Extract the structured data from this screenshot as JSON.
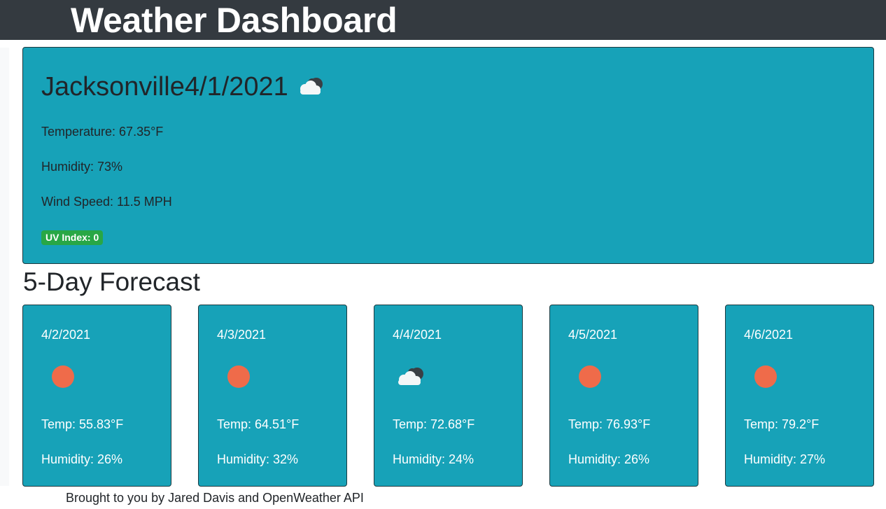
{
  "header": {
    "title": "Weather Dashboard"
  },
  "current": {
    "city": "Jacksonville",
    "date": "4/1/2021",
    "icon": "cloud-icon",
    "temperature": "Temperature: 67.35°F",
    "humidity": "Humidity: 73%",
    "wind": "Wind Speed: 11.5 MPH",
    "uv": "UV Index: 0",
    "uv_color": "#28a745"
  },
  "forecast": {
    "title": "5-Day Forecast",
    "days": [
      {
        "date": "4/2/2021",
        "icon": "sun-icon",
        "temp": "Temp: 55.83°F",
        "humidity": "Humidity: 26%"
      },
      {
        "date": "4/3/2021",
        "icon": "sun-icon",
        "temp": "Temp: 64.51°F",
        "humidity": "Humidity: 32%"
      },
      {
        "date": "4/4/2021",
        "icon": "cloud-icon",
        "temp": "Temp: 72.68°F",
        "humidity": "Humidity: 24%"
      },
      {
        "date": "4/5/2021",
        "icon": "sun-icon",
        "temp": "Temp: 76.93°F",
        "humidity": "Humidity: 26%"
      },
      {
        "date": "4/6/2021",
        "icon": "sun-icon",
        "temp": "Temp: 79.2°F",
        "humidity": "Humidity: 27%"
      }
    ]
  },
  "footer": {
    "text": "Brought to you by Jared Davis and OpenWeather API"
  },
  "colors": {
    "card": "#17a2b8",
    "header": "#343a40",
    "sun": "#ef6b4a"
  }
}
